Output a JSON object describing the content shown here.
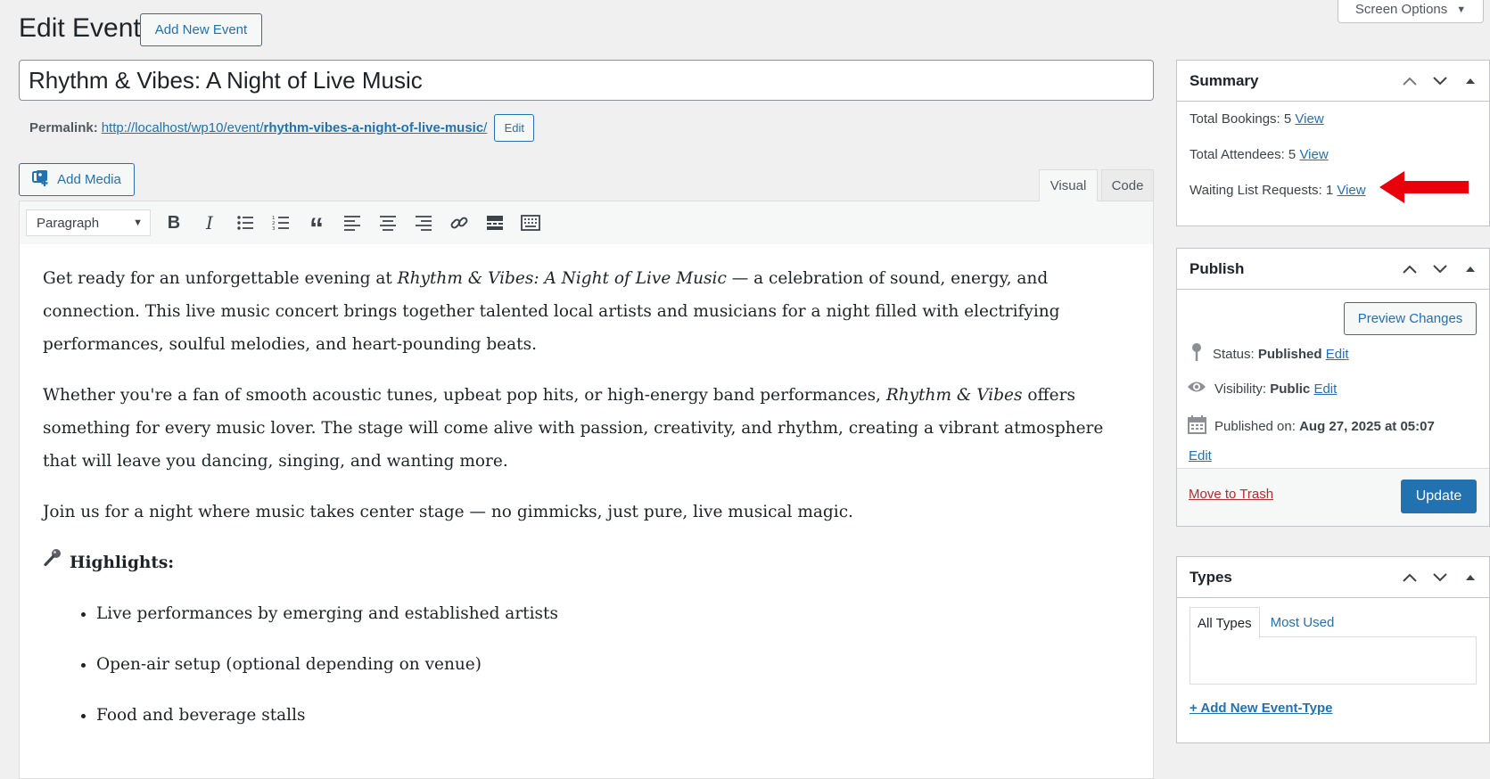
{
  "header": {
    "title": "Edit Event",
    "add_new_label": "Add New Event",
    "screen_options_label": "Screen Options"
  },
  "post": {
    "title": "Rhythm & Vibes: A Night of Live Music",
    "permalink_label": "Permalink:",
    "permalink_base": "http://localhost/wp10/event/",
    "permalink_slug": "rhythm-vibes-a-night-of-live-music",
    "permalink_trail": "/",
    "permalink_edit_label": "Edit"
  },
  "editor": {
    "add_media_label": "Add Media",
    "tab_visual": "Visual",
    "tab_code": "Code",
    "format_selected": "Paragraph",
    "toolbar_icons": [
      "bold-icon",
      "italic-icon",
      "bulleted-list-icon",
      "numbered-list-icon",
      "blockquote-icon",
      "align-left-icon",
      "align-center-icon",
      "align-right-icon",
      "link-icon",
      "read-more-icon",
      "toolbar-toggle-icon"
    ],
    "content": {
      "p1_a": "Get ready for an unforgettable evening at ",
      "p1_em": "Rhythm & Vibes: A Night of Live Music",
      "p1_b": " — a celebration of sound, energy, and connection. This live music concert brings together talented local artists and musicians for a night filled with electrifying performances, soulful melodies, and heart-pounding beats.",
      "p2_a": "Whether you're a fan of smooth acoustic tunes, upbeat pop hits, or high-energy band performances, ",
      "p2_em": "Rhythm & Vibes",
      "p2_b": " offers something for every music lover. The stage will come alive with passion, creativity, and rhythm, creating a vibrant atmosphere that will leave you dancing, singing, and wanting more.",
      "p3": "Join us for a night where music takes center stage — no gimmicks, just pure, live musical magic.",
      "highlights_heading": "Highlights:",
      "highlights": [
        "Live performances by emerging and established artists",
        "Open-air setup (optional depending on venue)",
        "Food and beverage stalls"
      ]
    }
  },
  "summary": {
    "title": "Summary",
    "bookings_label": "Total Bookings: 5",
    "attendees_label": "Total Attendees: 5",
    "waiting_label": "Waiting List Requests: 1",
    "view_label": "View"
  },
  "publish": {
    "title": "Publish",
    "preview_label": "Preview Changes",
    "status_label": "Status:",
    "status_value": "Published",
    "visibility_label": "Visibility:",
    "visibility_value": "Public",
    "published_on_label": "Published on:",
    "published_on_value": "Aug 27, 2025 at 05:07",
    "edit_label": "Edit",
    "trash_label": "Move to Trash",
    "update_label": "Update"
  },
  "types": {
    "title": "Types",
    "tab_all": "All Types",
    "tab_most_used": "Most Used",
    "add_new_label": "+ Add New Event-Type"
  },
  "colors": {
    "accent": "#2271b1",
    "annotation_arrow": "#e8000b",
    "trash": "#b32d2e",
    "background": "#f0f0f1"
  }
}
